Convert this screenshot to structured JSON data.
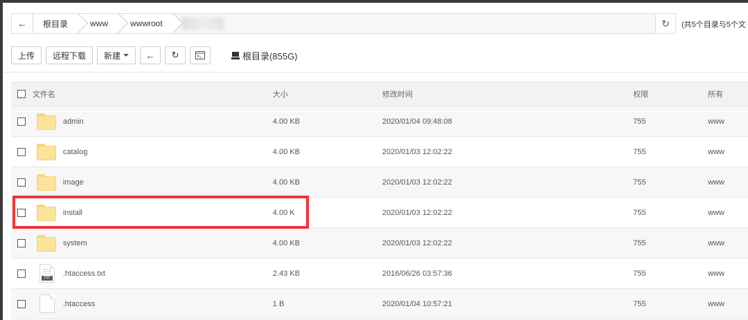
{
  "pathbar": {
    "crumbs": [
      "根目录",
      "www",
      "wwwroot"
    ],
    "summary": "(共5个目录与5个文"
  },
  "toolbar": {
    "upload_label": "上传",
    "remote_download_label": "远程下载",
    "new_label": "新建",
    "disk_label": "根目录(855G)"
  },
  "table": {
    "headers": [
      "文件名",
      "大小",
      "修改时间",
      "权限",
      "所有"
    ],
    "rows": [
      {
        "name": "admin",
        "type": "folder",
        "size": "4.00 KB",
        "mtime": "2020/01/04 09:48:08",
        "perm": "755",
        "owner": "www"
      },
      {
        "name": "catalog",
        "type": "folder",
        "size": "4.00 KB",
        "mtime": "2020/01/03 12:02:22",
        "perm": "755",
        "owner": "www"
      },
      {
        "name": "image",
        "type": "folder",
        "size": "4.00 KB",
        "mtime": "2020/01/03 12:02:22",
        "perm": "755",
        "owner": "www"
      },
      {
        "name": "install",
        "type": "folder",
        "size": "4.00 K",
        "mtime": "2020/01/03 12:02:22",
        "perm": "755",
        "owner": "www"
      },
      {
        "name": "system",
        "type": "folder",
        "size": "4.00 KB",
        "mtime": "2020/01/03 12:02:22",
        "perm": "755",
        "owner": "www"
      },
      {
        "name": ".htaccess.txt",
        "type": "txt",
        "size": "2.43 KB",
        "mtime": "2016/06/26 03:57:36",
        "perm": "755",
        "owner": "www"
      },
      {
        "name": ".htaccess",
        "type": "file",
        "size": "1 B",
        "mtime": "2020/01/04 10:57:21",
        "perm": "755",
        "owner": "www"
      }
    ]
  },
  "colors": {
    "highlight": "#f0343a",
    "folder": "#fbe39a"
  }
}
